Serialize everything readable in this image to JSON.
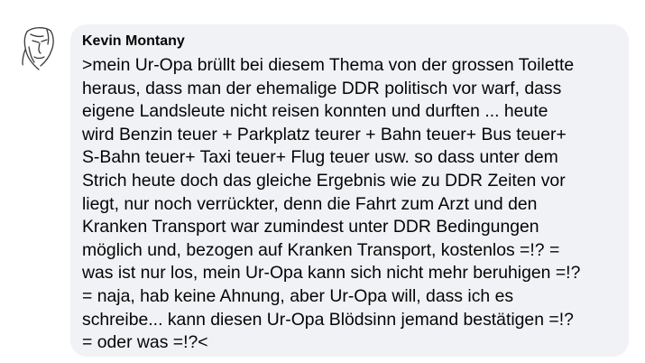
{
  "comment": {
    "author": "Kevin Montany",
    "avatar_icon": "sketch-face-avatar-icon",
    "text": ">mein Ur-Opa brüllt bei diesem Thema von der grossen Toilette\nheraus, dass man der ehemalige DDR politisch vor warf, dass\neigene Landsleute nicht reisen konnten und durften ... heute\nwird Benzin teuer + Parkplatz teurer + Bahn teuer+ Bus teuer+\nS-Bahn teuer+ Taxi teuer+ Flug teuer usw. so dass unter dem\nStrich heute doch das gleiche Ergebnis wie zu DDR Zeiten vor\nliegt, nur noch verrückter, denn die Fahrt zum Arzt und den\nKranken Transport war zumindest unter DDR Bedingungen\nmöglich und, bezogen auf Kranken Transport, kostenlos =!? =\nwas ist nur los, mein Ur-Opa kann sich nicht mehr beruhigen =!?\n= naja, hab keine Ahnung, aber Ur-Opa will, dass ich es\nschreibe... kann diesen Ur-Opa Blödsinn jemand bestätigen =!?\n= oder was =!?<"
  },
  "colors": {
    "bubble_background": "#f0f2f5",
    "text": "#050505"
  }
}
